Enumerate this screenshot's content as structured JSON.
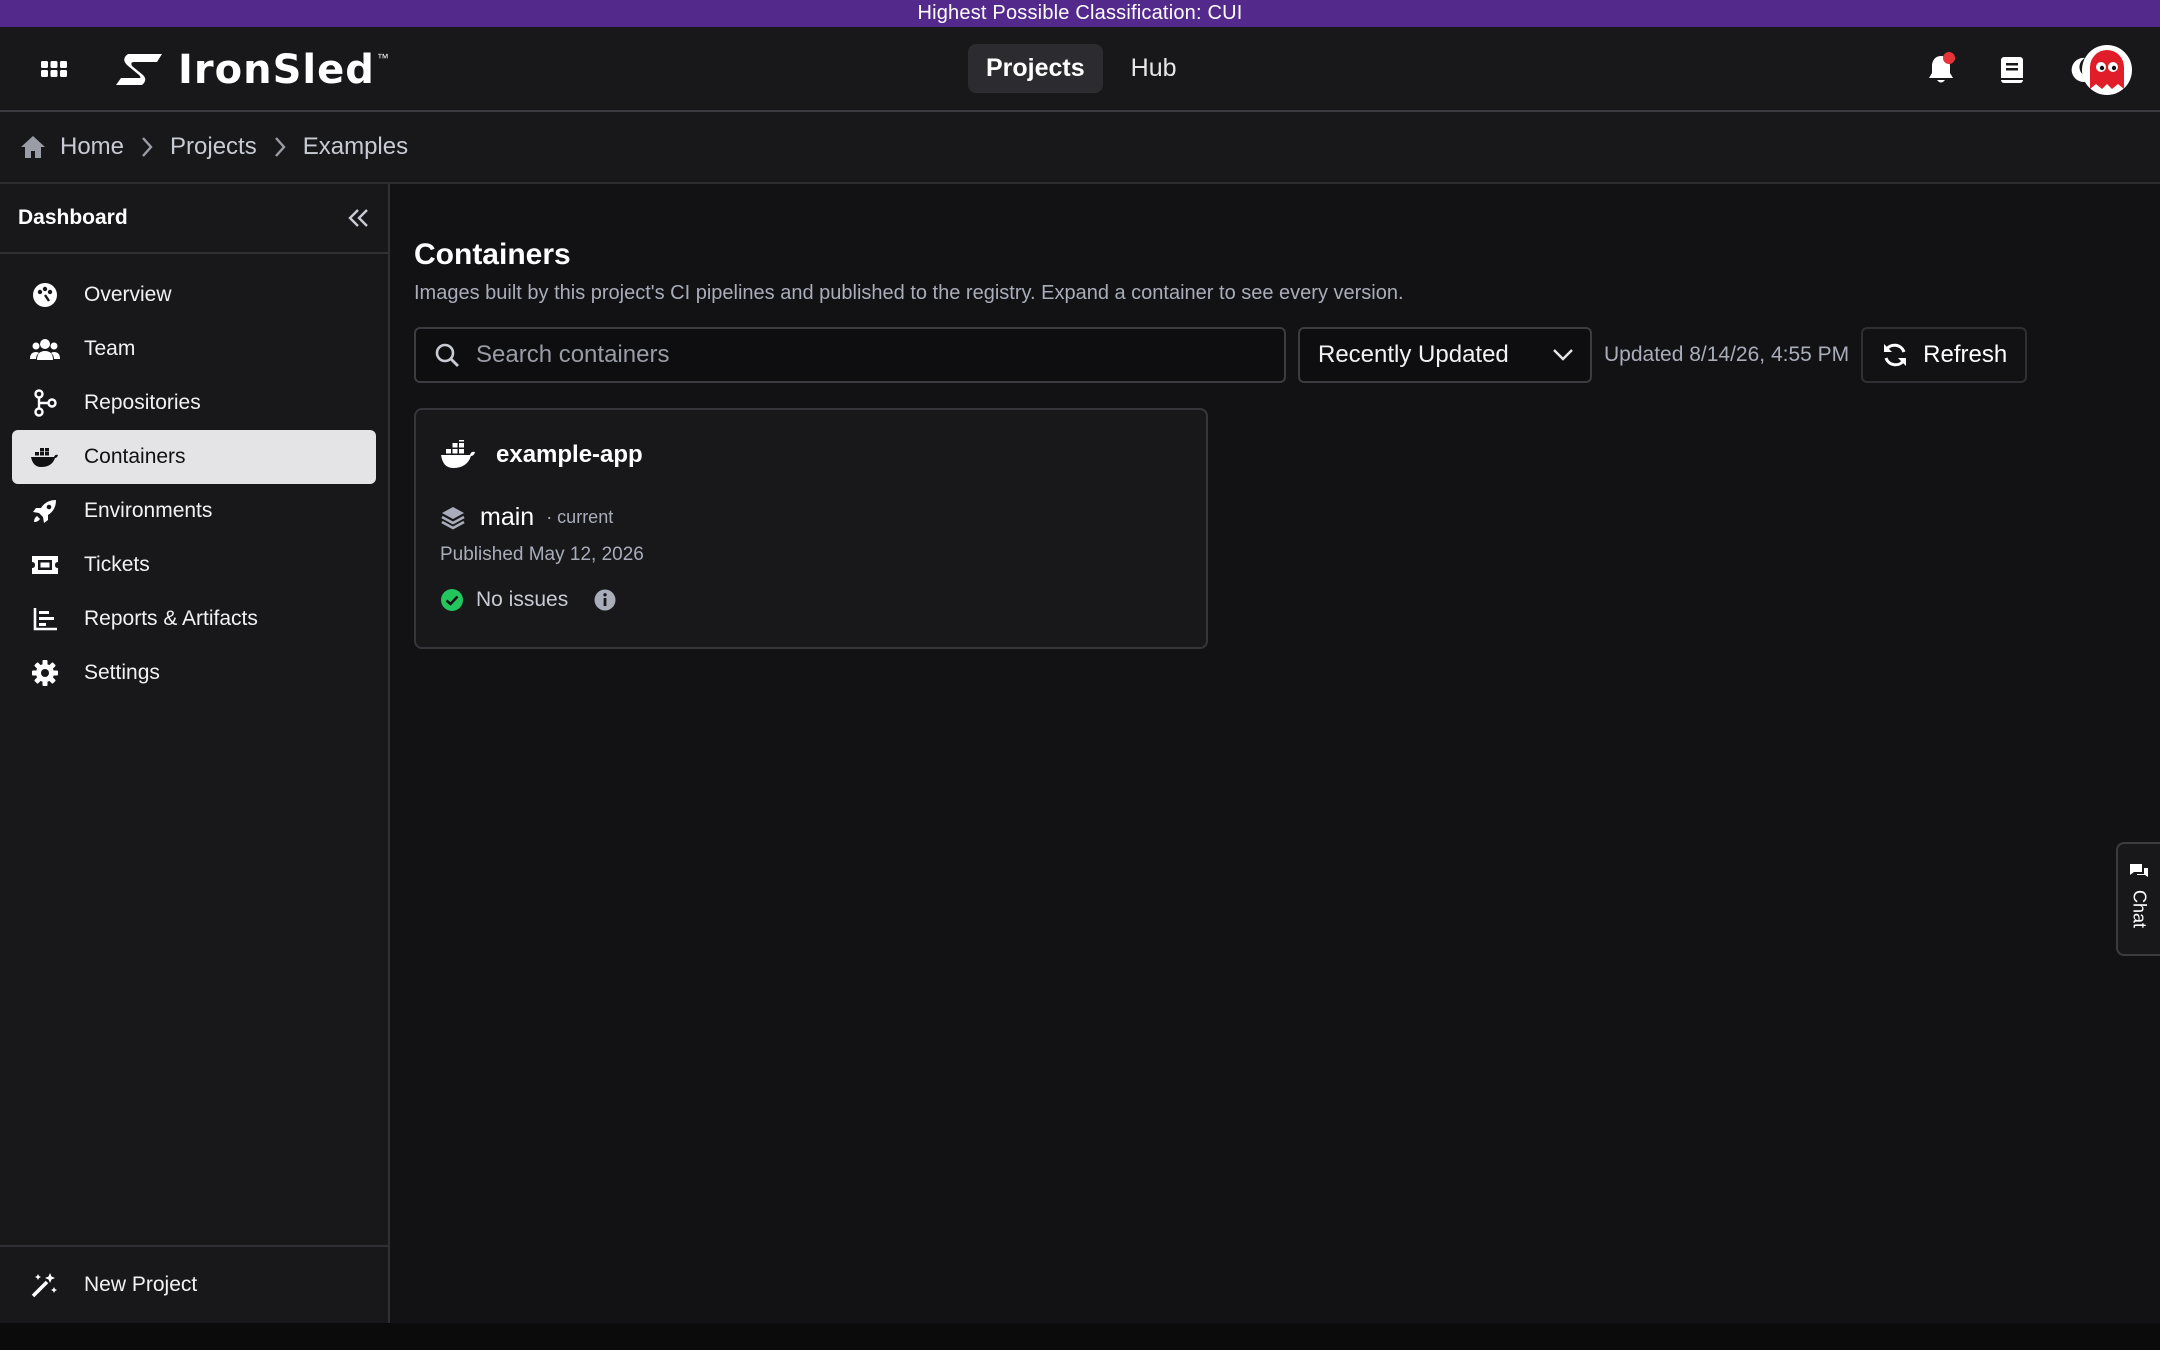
{
  "classification_banner": "Highest Possible Classification: CUI",
  "header": {
    "brand": "IronSled",
    "trademark": "™",
    "nav": [
      {
        "label": "Projects",
        "active": true
      },
      {
        "label": "Hub",
        "active": false
      }
    ],
    "icons": [
      "apps-grid-icon",
      "bell-icon",
      "book-icon",
      "moon-icon",
      "avatar"
    ],
    "has_notification": true
  },
  "breadcrumb": {
    "items": [
      "Home",
      "Projects",
      "Examples"
    ]
  },
  "sidebar": {
    "title": "Dashboard",
    "items": [
      {
        "label": "Overview",
        "icon": "palette-icon",
        "active": false
      },
      {
        "label": "Team",
        "icon": "users-icon",
        "active": false
      },
      {
        "label": "Repositories",
        "icon": "git-branch-icon",
        "active": false
      },
      {
        "label": "Containers",
        "icon": "docker-icon",
        "active": true
      },
      {
        "label": "Environments",
        "icon": "rocket-icon",
        "active": false
      },
      {
        "label": "Tickets",
        "icon": "ticket-icon",
        "active": false
      },
      {
        "label": "Reports & Artifacts",
        "icon": "chart-icon",
        "active": false
      },
      {
        "label": "Settings",
        "icon": "gear-icon",
        "active": false
      }
    ],
    "footer": {
      "label": "New Project",
      "icon": "magic-wand-icon"
    }
  },
  "main": {
    "title": "Containers",
    "subtitle": "Images built by this project's CI pipelines and published to the registry. Expand a container to see every version.",
    "search": {
      "placeholder": "Search containers",
      "value": ""
    },
    "sort": {
      "selected": "Recently Updated"
    },
    "updated_text": "Updated 8/14/26, 4:55 PM",
    "refresh_label": "Refresh",
    "containers": [
      {
        "name": "example-app",
        "version": "main",
        "version_tag": "· current",
        "published": "Published May 12, 2026",
        "status": "No issues"
      }
    ]
  },
  "chat": {
    "label": "Chat"
  },
  "colors": {
    "classification_bar": "#54298c",
    "background": "#121214",
    "panel": "#18181b",
    "active_item": "#e4e4e6",
    "success": "#22c55e",
    "notification": "#e5343a",
    "avatar_red": "#e11d2a"
  }
}
